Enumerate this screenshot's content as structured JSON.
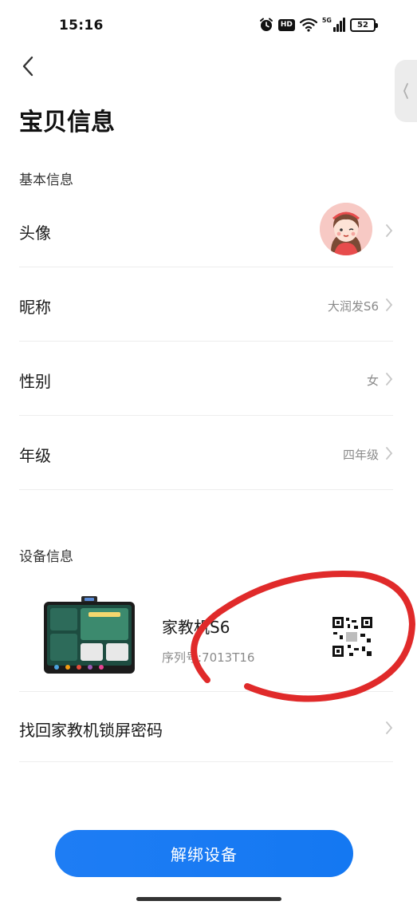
{
  "status_bar": {
    "time": "15:16",
    "hd_label": "HD",
    "network_label": "5G",
    "battery": "52"
  },
  "header": {
    "title": "宝贝信息"
  },
  "basic_section": {
    "title": "基本信息",
    "rows": [
      {
        "label": "头像",
        "value": ""
      },
      {
        "label": "昵称",
        "value": "大润发S6"
      },
      {
        "label": "性别",
        "value": "女"
      },
      {
        "label": "年级",
        "value": "四年级"
      }
    ]
  },
  "device_section": {
    "title": "设备信息",
    "device_name": "家教机S6",
    "serial": "序列号:7013T16"
  },
  "recover_row": {
    "label": "找回家教机锁屏密码"
  },
  "actions": {
    "unbind_label": "解绑设备"
  },
  "icons": {
    "back": "back-chevron-icon",
    "side_tab": "collapse-chevron-icon",
    "row_arrow": "chevron-right-icon",
    "alarm": "alarm-icon",
    "wifi": "wifi-icon",
    "signal": "signal-icon",
    "battery": "battery-icon"
  },
  "colors": {
    "primary": "#1478f2",
    "annotation": "#e02a2a",
    "muted_text": "#8a8a8a"
  }
}
